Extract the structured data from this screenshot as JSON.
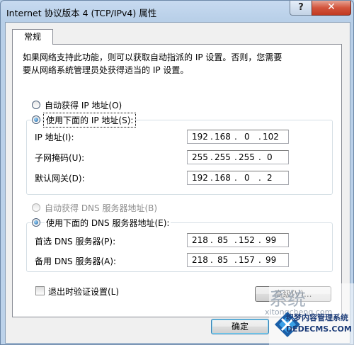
{
  "window": {
    "title": "Internet 协议版本 4 (TCP/IPv4) 属性",
    "help_label": "?",
    "close_label": "✕"
  },
  "tabs": [
    {
      "label": "常规"
    }
  ],
  "description": {
    "line1": "如果网络支持此功能，则可以获取自动指派的 IP 设置。否则，您需要",
    "line2": "要从网络系统管理员处获得适当的 IP 设置。"
  },
  "ip": {
    "auto_label": "自动获得 IP 地址(O)",
    "manual_label": "使用下面的 IP 地址(S):",
    "manual_checked": true,
    "fields": [
      {
        "label": "IP 地址(I):",
        "octets": [
          "192",
          "168",
          "0",
          "102"
        ]
      },
      {
        "label": "子网掩码(U):",
        "octets": [
          "255",
          "255",
          "255",
          "0"
        ]
      },
      {
        "label": "默认网关(D):",
        "octets": [
          "192",
          "168",
          "0",
          "2"
        ]
      }
    ]
  },
  "dns": {
    "auto_label": "自动获得 DNS 服务器地址(B)",
    "manual_label": "使用下面的 DNS 服务器地址(E):",
    "manual_checked": true,
    "fields": [
      {
        "label": "首选 DNS 服务器(P):",
        "octets": [
          "218",
          "85",
          "152",
          "99"
        ]
      },
      {
        "label": "备用 DNS 服务器(A):",
        "octets": [
          "218",
          "85",
          "157",
          "99"
        ]
      }
    ]
  },
  "validate_label": "退出时验证设置(L)",
  "validate_checked": false,
  "advanced_label": "高级(V)...",
  "ok_label": "确定",
  "watermark": {
    "big": "系统",
    "sub": "xitongcheng.com",
    "line1": "织梦内容管理系统",
    "line2": "DEDECMS.COM"
  }
}
